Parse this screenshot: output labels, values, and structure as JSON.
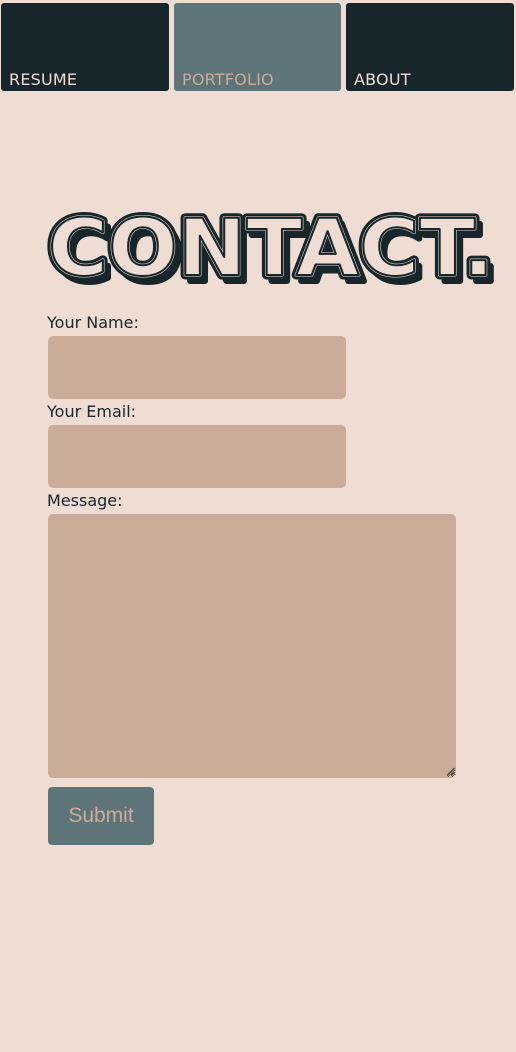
{
  "nav": {
    "tabs": [
      {
        "label": "RESUME",
        "active": false
      },
      {
        "label": "PORTFOLIO",
        "active": true
      },
      {
        "label": "ABOUT",
        "active": false
      }
    ]
  },
  "page": {
    "title": "CONTACT."
  },
  "form": {
    "name_label": "Your Name:",
    "name_value": "",
    "email_label": "Your Email:",
    "email_value": "",
    "message_label": "Message:",
    "message_value": "",
    "submit_label": "Submit"
  },
  "colors": {
    "background": "#efdcd2",
    "dark": "#17262a",
    "slate": "#5d7579",
    "field": "#cbac98"
  }
}
